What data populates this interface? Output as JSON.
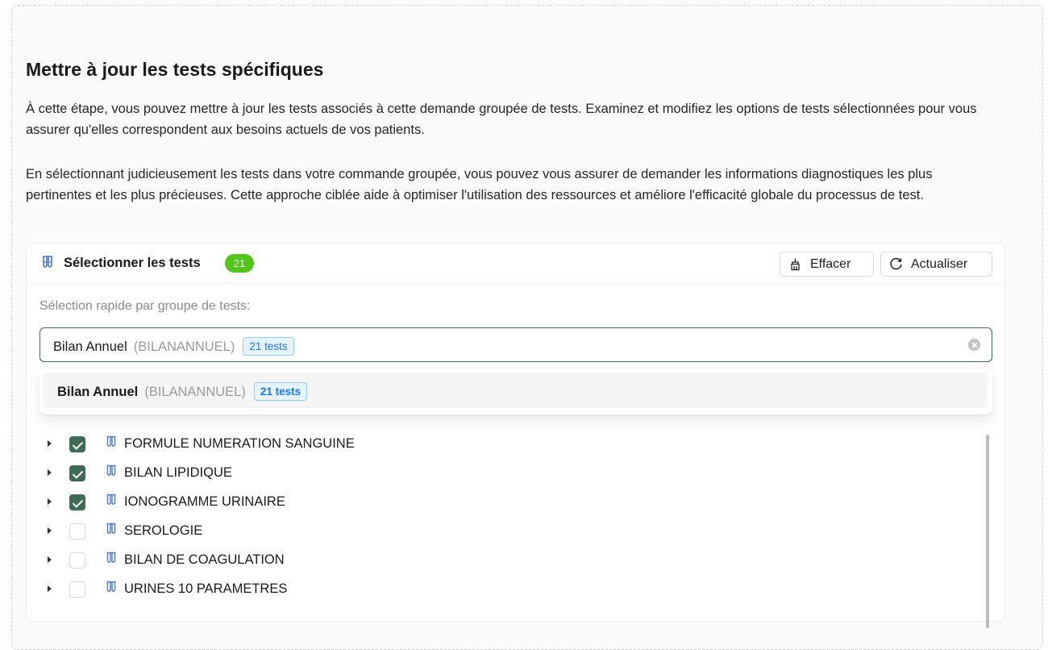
{
  "page": {
    "title": "Mettre à jour les tests spécifiques",
    "paragraph1": "À cette étape, vous pouvez mettre à jour les tests associés à cette demande groupée de tests. Examinez et modifiez les options de tests sélectionnées pour vous assurer qu'elles correspondent aux besoins actuels de vos patients.",
    "paragraph2": "En sélectionnant judicieusement les tests dans votre commande groupée, vous pouvez vous assurer de demander les informations diagnostiques les plus pertinentes et les plus précieuses. Cette approche ciblée aide à optimiser l'utilisation des ressources et améliore l'efficacité globale du processus de test."
  },
  "card": {
    "title": "Sélectionner les tests",
    "count": "21",
    "clear_label": "Effacer",
    "refresh_label": "Actualiser",
    "quick_select_label": "Sélection rapide par groupe de tests:"
  },
  "select": {
    "value_name": "Bilan Annuel",
    "value_code": "(BILANANNUEL)",
    "value_tag": "21 tests"
  },
  "dropdown": {
    "options": [
      {
        "name": "Bilan Annuel",
        "code": "(BILANANNUEL)",
        "tag": "21 tests"
      }
    ]
  },
  "tree": {
    "items": [
      {
        "label": "FORMULE NUMERATION SANGUINE",
        "checked": true
      },
      {
        "label": "BILAN LIPIDIQUE",
        "checked": true
      },
      {
        "label": "IONOGRAMME URINAIRE",
        "checked": true
      },
      {
        "label": "SEROLOGIE",
        "checked": false
      },
      {
        "label": "BILAN DE COAGULATION",
        "checked": false
      },
      {
        "label": "URINES 10 PARAMETRES",
        "checked": false
      }
    ]
  },
  "colors": {
    "accent": "#3d6b55",
    "badge": "#52c41a",
    "tag_text": "#1677ff",
    "icon_blue": "#4a78c9"
  },
  "icons": {
    "header": "test-tubes-icon",
    "clear": "clear-icon",
    "refresh": "reload-icon",
    "row": "test-tubes-icon"
  }
}
